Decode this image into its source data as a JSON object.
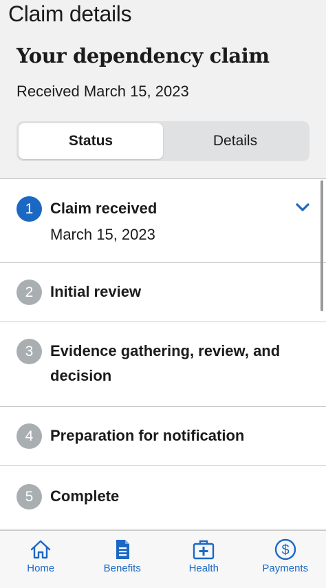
{
  "header": {
    "page_title": "Claim details",
    "claim_title": "Your dependency claim",
    "received_text": "Received March 15, 2023"
  },
  "segmented": {
    "status_label": "Status",
    "details_label": "Details",
    "selected": "Status"
  },
  "steps": [
    {
      "number": "1",
      "label": "Claim received",
      "date": "March 15, 2023",
      "current": true,
      "expanded": true
    },
    {
      "number": "2",
      "label": "Initial review"
    },
    {
      "number": "3",
      "label": "Evidence gathering, review, and decision"
    },
    {
      "number": "4",
      "label": "Preparation for notification"
    },
    {
      "number": "5",
      "label": "Complete"
    }
  ],
  "tabbar": {
    "items": [
      {
        "label": "Home",
        "icon": "home-icon"
      },
      {
        "label": "Benefits",
        "icon": "benefits-document-icon"
      },
      {
        "label": "Health",
        "icon": "health-medical-bag-icon"
      },
      {
        "label": "Payments",
        "icon": "payments-dollar-icon"
      }
    ]
  },
  "colors": {
    "accent": "#1b68c4",
    "inactive_step": "#a9aeb1",
    "header_bg": "#f1f1f1",
    "segment_bg": "#dfe1e2"
  }
}
